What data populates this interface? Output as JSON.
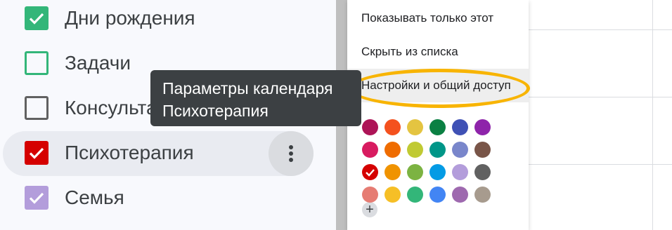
{
  "sidebar": {
    "items": [
      {
        "label": "Дни рождения",
        "color": "#33b679",
        "checked": true
      },
      {
        "label": "Задачи",
        "color": "#33b679",
        "checked": false
      },
      {
        "label": "Консульта",
        "color": "#616161",
        "checked": false
      },
      {
        "label": "Психотерапия",
        "color": "#d50000",
        "checked": true,
        "active": true
      },
      {
        "label": "Семья",
        "color": "#b39ddb",
        "checked": true
      }
    ],
    "more_icon": "more-vert-icon"
  },
  "tooltip": {
    "line1": "Параметры календаря",
    "line2": "Психотерапия"
  },
  "menu": {
    "items": [
      {
        "label": "Показывать только этот"
      },
      {
        "label": "Скрыть из списка"
      },
      {
        "label": "Настройки и общий доступ"
      }
    ],
    "annotation_color": "#f8b400",
    "palette": [
      [
        "#ad1457",
        "#f4511e",
        "#e4c441",
        "#0b8043",
        "#3f51b5",
        "#8e24aa"
      ],
      [
        "#d81b60",
        "#ef6c00",
        "#c0ca33",
        "#009688",
        "#7986cb",
        "#795548"
      ],
      [
        "#d50000",
        "#f09300",
        "#7cb342",
        "#039be5",
        "#b39ddb",
        "#616161"
      ],
      [
        "#e67c73",
        "#f6bf26",
        "#33b679",
        "#4285f4",
        "#9e69af",
        "#a79b8e"
      ]
    ],
    "selected_color": "#d50000",
    "add_color_icon": "plus-icon",
    "add_color_glyph": "+"
  }
}
